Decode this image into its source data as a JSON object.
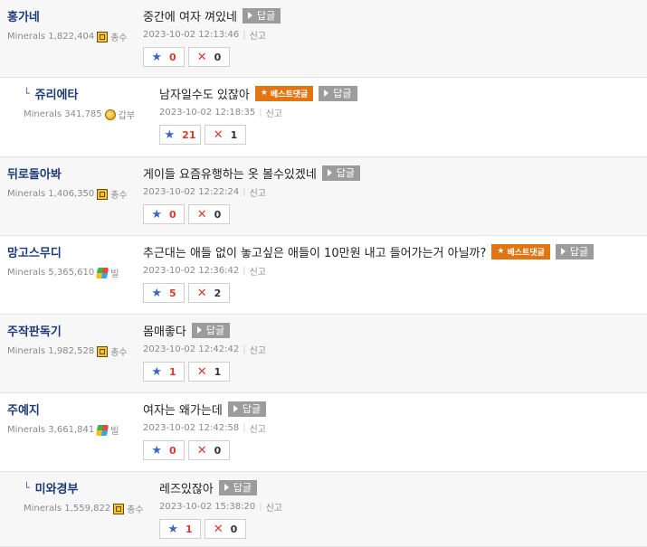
{
  "labels": {
    "reply_button": "답글",
    "best_badge": "베스트댓글",
    "report": "신고"
  },
  "comments": [
    {
      "nick": "홍가네",
      "reply": false,
      "minerals": "Minerals 1,822,404",
      "rank": "총수",
      "rank_icon": "rank-box-icon",
      "text": "중간에 여자 껴있네",
      "best": false,
      "date": "2023-10-02 12:13:46",
      "up": "0",
      "down": "0"
    },
    {
      "nick": "쥬리에타",
      "reply": true,
      "minerals": "Minerals 341,785",
      "rank": "갑부",
      "rank_icon": "coins-icon",
      "text": "남자일수도 있잖아",
      "best": true,
      "date": "2023-10-02 12:18:35",
      "up": "21",
      "down": "1"
    },
    {
      "nick": "뒤로돌아봐",
      "reply": false,
      "minerals": "Minerals 1,406,350",
      "rank": "총수",
      "rank_icon": "rank-box-icon",
      "text": "게이들 요즘유행하는 옷 볼수있겠네",
      "best": false,
      "date": "2023-10-02 12:22:24",
      "up": "0",
      "down": "0"
    },
    {
      "nick": "망고스무디",
      "reply": false,
      "minerals": "Minerals 5,365,610",
      "rank": "빌",
      "rank_icon": "windows-flag-icon",
      "text": "추근대는 애들 없이 놓고싶은 애들이 10만원 내고 들어가는거 아닐까?",
      "best": true,
      "date": "2023-10-02 12:36:42",
      "up": "5",
      "down": "2"
    },
    {
      "nick": "주작판독기",
      "reply": false,
      "minerals": "Minerals 1,982,528",
      "rank": "총수",
      "rank_icon": "rank-box-icon",
      "text": "몸매좋다",
      "best": false,
      "date": "2023-10-02 12:42:42",
      "up": "1",
      "down": "1"
    },
    {
      "nick": "주예지",
      "reply": false,
      "minerals": "Minerals 3,661,841",
      "rank": "빌",
      "rank_icon": "windows-flag-icon",
      "text": "여자는 왜가는데",
      "best": false,
      "date": "2023-10-02 12:42:58",
      "up": "0",
      "down": "0"
    },
    {
      "nick": "미와경부",
      "reply": true,
      "minerals": "Minerals 1,559,822",
      "rank": "총수",
      "rank_icon": "rank-box-icon",
      "text": "레즈있잖아",
      "best": false,
      "date": "2023-10-02 15:38:20",
      "up": "1",
      "down": "0"
    }
  ]
}
